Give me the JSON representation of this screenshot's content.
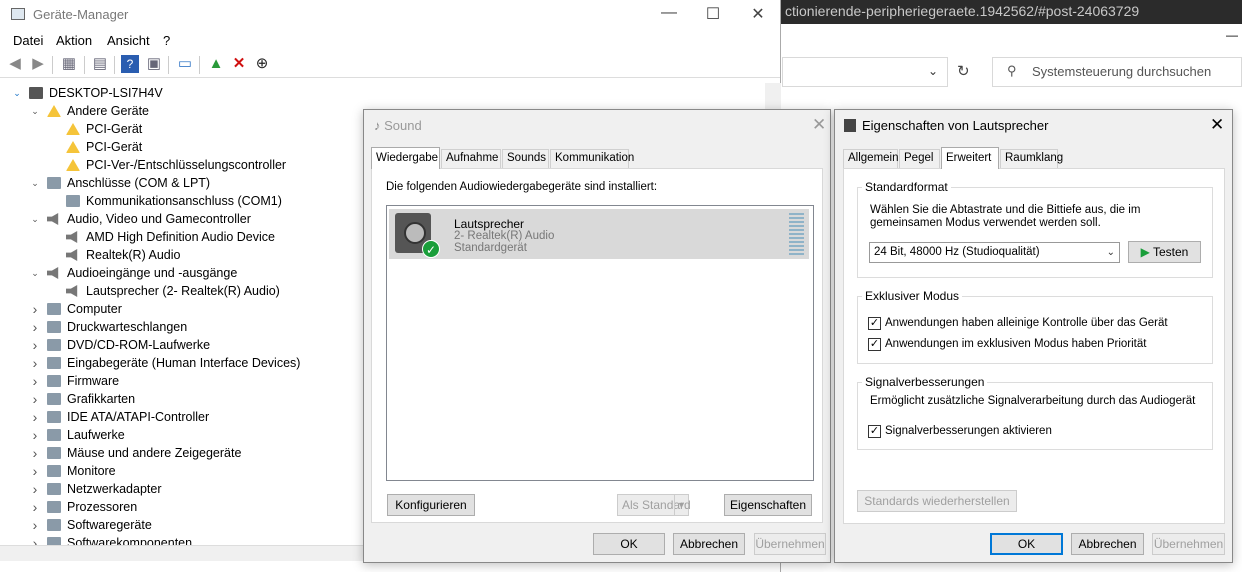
{
  "browser": {
    "url": "ctionierende-peripheriegeraete.1942562/#post-24063729",
    "search_placeholder": "Systemsteuerung durchsuchen"
  },
  "devmgr": {
    "title": "Geräte-Manager",
    "menu": [
      "Datei",
      "Aktion",
      "Ansicht",
      "?"
    ],
    "root": "DESKTOP-LSI7H4V",
    "tree": [
      {
        "label": "Andere Geräte",
        "level": 1,
        "expanded": true,
        "icon": "warning-device-icon"
      },
      {
        "label": "PCI-Gerät",
        "level": 2,
        "icon": "warning-icon"
      },
      {
        "label": "PCI-Gerät",
        "level": 2,
        "icon": "warning-icon"
      },
      {
        "label": "PCI-Ver-/Entschlüsselungscontroller",
        "level": 2,
        "icon": "warning-icon"
      },
      {
        "label": "Anschlüsse (COM & LPT)",
        "level": 1,
        "expanded": true,
        "icon": "port-icon"
      },
      {
        "label": "Kommunikationsanschluss (COM1)",
        "level": 2,
        "icon": "port-icon"
      },
      {
        "label": "Audio, Video und Gamecontroller",
        "level": 1,
        "expanded": true,
        "icon": "speaker-icon"
      },
      {
        "label": "AMD High Definition Audio Device",
        "level": 2,
        "icon": "speaker-icon"
      },
      {
        "label": "Realtek(R) Audio",
        "level": 2,
        "icon": "speaker-icon"
      },
      {
        "label": "Audioeingänge und -ausgänge",
        "level": 1,
        "expanded": true,
        "icon": "speaker-icon"
      },
      {
        "label": "Lautsprecher (2- Realtek(R) Audio)",
        "level": 2,
        "icon": "speaker-icon"
      },
      {
        "label": "Computer",
        "level": 1,
        "expanded": false,
        "icon": "computer-icon"
      },
      {
        "label": "Druckwarteschlangen",
        "level": 1,
        "expanded": false,
        "icon": "printer-icon"
      },
      {
        "label": "DVD/CD-ROM-Laufwerke",
        "level": 1,
        "expanded": false,
        "icon": "disc-icon"
      },
      {
        "label": "Eingabegeräte (Human Interface Devices)",
        "level": 1,
        "expanded": false,
        "icon": "hid-icon"
      },
      {
        "label": "Firmware",
        "level": 1,
        "expanded": false,
        "icon": "firmware-icon"
      },
      {
        "label": "Grafikkarten",
        "level": 1,
        "expanded": false,
        "icon": "display-adapter-icon"
      },
      {
        "label": "IDE ATA/ATAPI-Controller",
        "level": 1,
        "expanded": false,
        "icon": "ide-icon"
      },
      {
        "label": "Laufwerke",
        "level": 1,
        "expanded": false,
        "icon": "drive-icon"
      },
      {
        "label": "Mäuse und andere Zeigegeräte",
        "level": 1,
        "expanded": false,
        "icon": "mouse-icon"
      },
      {
        "label": "Monitore",
        "level": 1,
        "expanded": false,
        "icon": "monitor-icon"
      },
      {
        "label": "Netzwerkadapter",
        "level": 1,
        "expanded": false,
        "icon": "network-icon"
      },
      {
        "label": "Prozessoren",
        "level": 1,
        "expanded": false,
        "icon": "cpu-icon"
      },
      {
        "label": "Softwaregeräte",
        "level": 1,
        "expanded": false,
        "icon": "software-icon"
      },
      {
        "label": "Softwarekomponenten",
        "level": 1,
        "expanded": false,
        "icon": "software-icon"
      }
    ]
  },
  "sound": {
    "title": "Sound",
    "tabs": [
      "Wiedergabe",
      "Aufnahme",
      "Sounds",
      "Kommunikation"
    ],
    "intro": "Die folgenden Audiowiedergabegeräte sind installiert:",
    "device": {
      "name": "Lautsprecher",
      "driver": "2- Realtek(R) Audio",
      "status": "Standardgerät"
    },
    "buttons": {
      "configure": "Konfigurieren",
      "default": "Als Standard",
      "properties": "Eigenschaften",
      "ok": "OK",
      "cancel": "Abbrechen",
      "apply": "Übernehmen"
    }
  },
  "props": {
    "title": "Eigenschaften von Lautsprecher",
    "tabs": [
      "Allgemein",
      "Pegel",
      "Erweitert",
      "Raumklang"
    ],
    "format": {
      "group": "Standardformat",
      "desc1": "Wählen Sie die Abtastrate und die Bittiefe aus, die im",
      "desc2": "gemeinsamen Modus verwendet werden soll.",
      "value": "24 Bit, 48000 Hz (Studioqualität)",
      "test": "Testen"
    },
    "exclusive": {
      "group": "Exklusiver Modus",
      "opt1": "Anwendungen haben alleinige Kontrolle über das Gerät",
      "opt2": "Anwendungen im exklusiven Modus haben Priorität",
      "opt1_checked": true,
      "opt2_checked": true
    },
    "enhance": {
      "group": "Signalverbesserungen",
      "desc": "Ermöglicht zusätzliche Signalverarbeitung durch das Audiogerät",
      "opt": "Signalverbesserungen aktivieren",
      "opt_checked": true
    },
    "restore": "Standards wiederherstellen",
    "buttons": {
      "ok": "OK",
      "cancel": "Abbrechen",
      "apply": "Übernehmen"
    }
  }
}
